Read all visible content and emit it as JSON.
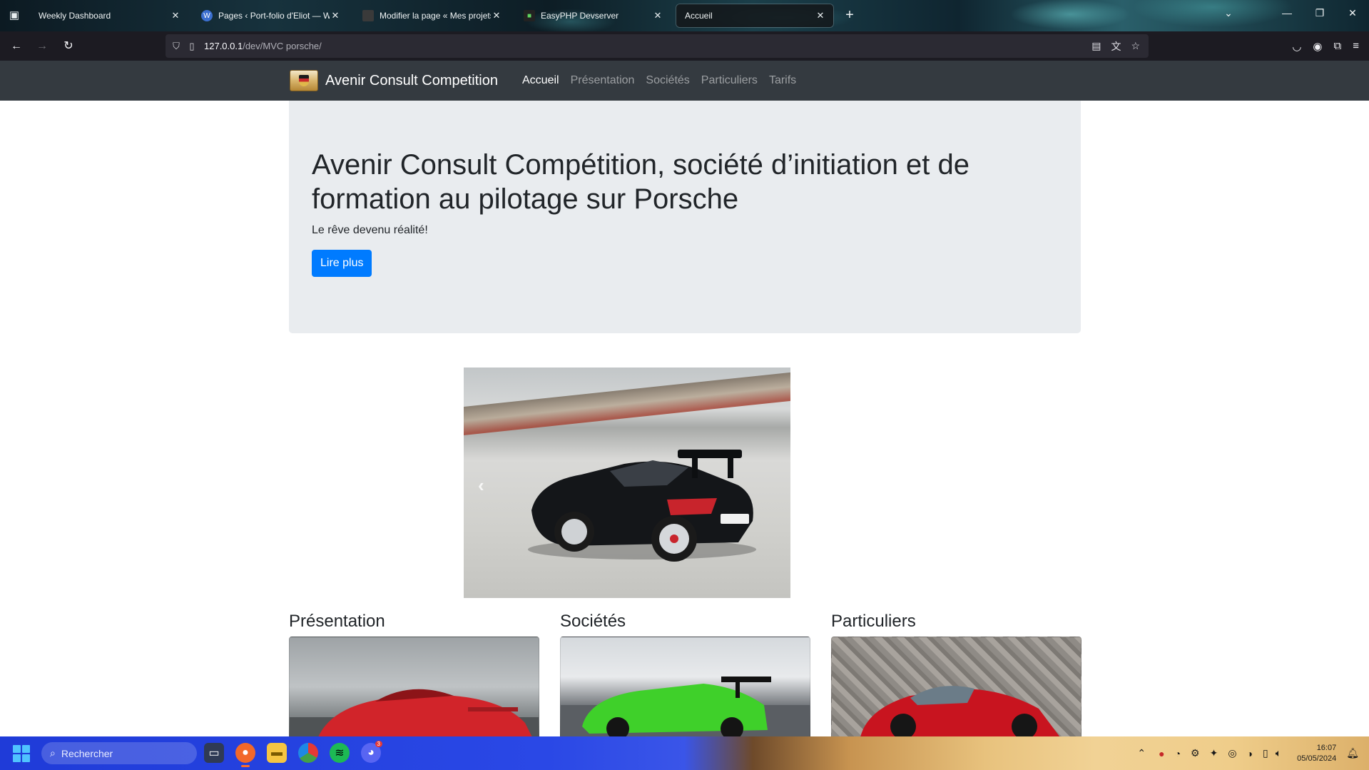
{
  "browser": {
    "tabs": [
      {
        "title": "Weekly Dashboard",
        "favicon": "dashboard-icon",
        "active": false
      },
      {
        "title": "Pages ‹ Port-folio d'Eliot — Wo",
        "favicon": "wordpress-icon",
        "active": false
      },
      {
        "title": "Modifier la page « Mes projets",
        "favicon": "wordpress-icon",
        "active": false
      },
      {
        "title": "EasyPHP Devserver",
        "favicon": "easyphp-icon",
        "active": false
      },
      {
        "title": "Accueil",
        "favicon": "",
        "active": true
      }
    ],
    "url_host": "127.0.0.1",
    "url_path": "/dev/MVC porsche/"
  },
  "site": {
    "brand": "Avenir Consult Competition",
    "nav": [
      {
        "label": "Accueil",
        "active": true
      },
      {
        "label": "Présentation",
        "active": false
      },
      {
        "label": "Sociétés",
        "active": false
      },
      {
        "label": "Particuliers",
        "active": false
      },
      {
        "label": "Tarifs",
        "active": false
      }
    ],
    "jumbotron": {
      "title": "Avenir Consult Compétition, société d’initiation et de formation au pilotage sur Porsche",
      "subtitle": "Le rêve devenu réalité!",
      "button": "Lire plus"
    },
    "carousel": {
      "prev_symbol": "‹"
    },
    "cards": [
      {
        "title": "Présentation",
        "car_color": "#d1242a"
      },
      {
        "title": "Sociétés",
        "car_color": "#3fd02a"
      },
      {
        "title": "Particuliers",
        "car_color": "#c8141f"
      }
    ]
  },
  "taskbar": {
    "search_placeholder": "Rechercher",
    "time": "16:07",
    "date": "05/05/2024",
    "discord_badge": "3"
  },
  "colors": {
    "navbar_bg": "#343a40",
    "jumbotron_bg": "#e9ecef",
    "primary": "#007bff"
  }
}
